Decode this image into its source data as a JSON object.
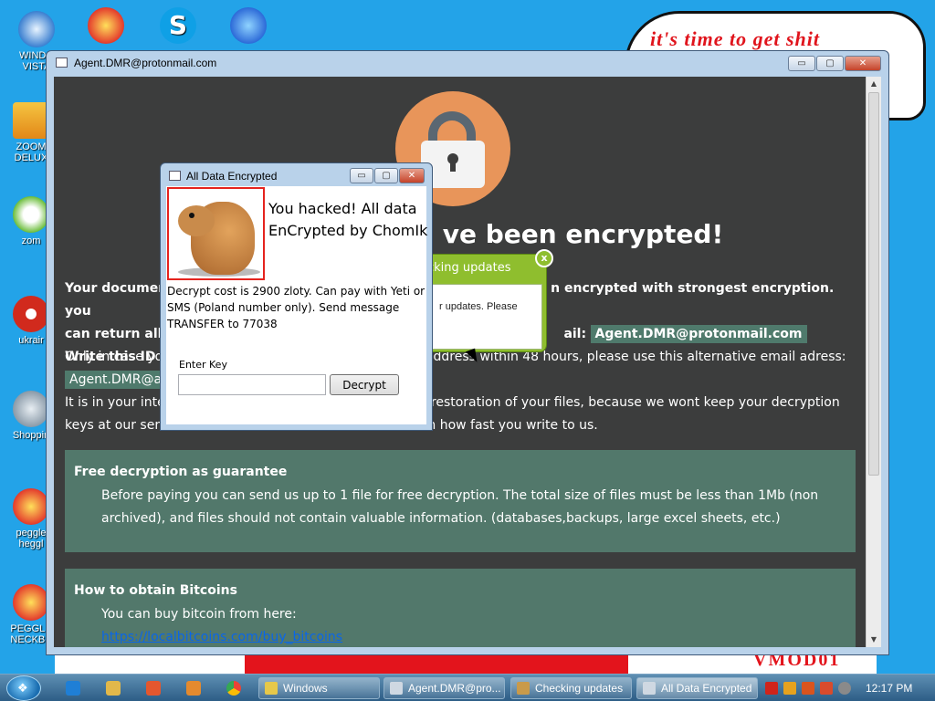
{
  "desktop": {
    "icons": [
      {
        "label": "WINDO\nVISTA",
        "color": "#3a7fd0"
      },
      {
        "label": "",
        "color": "#e33a2c"
      },
      {
        "label": "",
        "color": "#0fa0e6"
      },
      {
        "label": "",
        "color": "#2c6ad8"
      },
      {
        "label": "ZOOM\nDELUX",
        "color": "#e2a017"
      },
      {
        "label": "zom",
        "color": "#6bbd3a"
      },
      {
        "label": "ukrair",
        "color": "#d12a1d"
      },
      {
        "label": "Shoppin",
        "color": "#8a9aa8"
      },
      {
        "label": "peggle\nheggl",
        "color": "#e33a2c"
      },
      {
        "label": "PEGGLE\nNECKBE",
        "color": "#e33a2c"
      }
    ],
    "paint_text": "it's time to get shit",
    "paint_watermark": "VMOD01"
  },
  "main_window": {
    "title": "Agent.DMR@protonmail.com",
    "minimize": "▭",
    "maximize": "▢",
    "close": "✕",
    "headline": "ve been encrypted!",
    "para1_a": "Your documen",
    "para1_b": "n encrypted with strongest encryption. you",
    "para1_c": "can return all",
    "para1_d": "ail:",
    "email": "Agent.DMR@protonmail.com",
    "para1_e": "Write this ID i",
    "para2_a": "Only in case you",
    "para2_b": "ail address within 48 hours, please use this alternative email adress:",
    "email_alt": "Agent.DMR@ac",
    "para3_a": "It is in your inter",
    "para3_b": "the restoration of your files, because we wont keep your decryption",
    "para3_c": "keys at our serv",
    "para3_d": "n how fast you write to us.",
    "guarantee_title": "Free decryption as guarantee",
    "guarantee_text": "Before paying you can send us up to 1 file for free decryption. The total size of files must be less than 1Mb (non archived), and files should not contain valuable information. (databases,backups, large excel sheets, etc.)",
    "bitcoin_title": "How to obtain Bitcoins",
    "bitcoin_text": "You can buy bitcoin from here:",
    "bitcoin_link": "https://localbitcoins.com/buy_bitcoins"
  },
  "balloon": {
    "title": "cking updates",
    "body": "r updates. Please",
    "close": "x"
  },
  "dialog": {
    "title": "All Data Encrypted",
    "minimize": "▭",
    "maximize": "▢",
    "close": "✕",
    "hack_text": "You hacked! All data EnCrypted by ChomIk",
    "cost_text": "Decrypt cost is 2900 zloty. Can pay with Yeti or SMS (Poland number only). Send message TRANSFER to 77038",
    "key_label": "Enter Key",
    "key_value": "",
    "decrypt_button": "Decrypt"
  },
  "taskbar": {
    "buttons": [
      {
        "label": "Windows",
        "color": "#e6c84a"
      },
      {
        "label": "Agent.DMR@pro...",
        "color": "#cfd8e2"
      },
      {
        "label": "Checking updates",
        "color": "#c99a4a"
      },
      {
        "label": "All Data Encrypted",
        "color": "#cfd8e2"
      }
    ],
    "quick_launch_colors": [
      "#1f7fd6",
      "#e2b84a",
      "#e4572e",
      "#e48a2e",
      "#34a853"
    ],
    "tray_colors": [
      "#d0241b",
      "#e6a21e",
      "#d9541e",
      "#d94b2c",
      "#8a8a8a"
    ],
    "clock": "12:17 PM"
  }
}
